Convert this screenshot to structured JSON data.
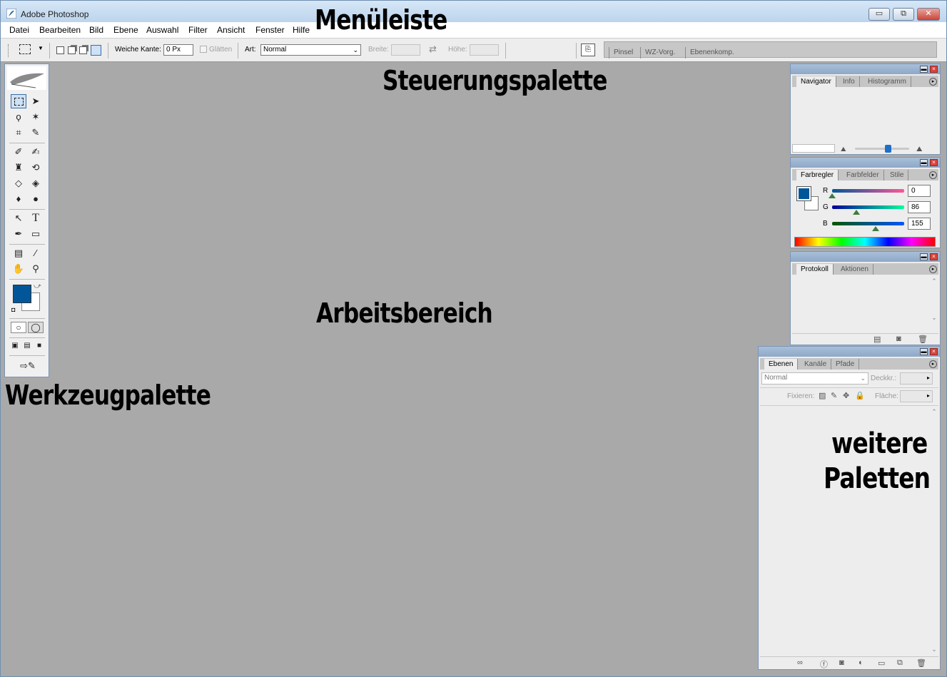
{
  "window": {
    "title": "Adobe Photoshop",
    "controls": {
      "minimize": "▭",
      "restore": "⧉",
      "close": "✕"
    }
  },
  "menu": [
    "Datei",
    "Bearbeiten",
    "Bild",
    "Ebene",
    "Auswahl",
    "Filter",
    "Ansicht",
    "Fenster",
    "Hilfe"
  ],
  "options": {
    "feather_label": "Weiche Kante:",
    "feather_value": "0 Px",
    "antialias_label": "Glätten",
    "style_label": "Art:",
    "style_value": "Normal",
    "width_label": "Breite:",
    "height_label": "Höhe:"
  },
  "palette_well": {
    "tabs": [
      "Pinsel",
      "WZ-Vorg.",
      "Ebenenkomp."
    ]
  },
  "navigator": {
    "tabs": [
      "Navigator",
      "Info",
      "Histogramm"
    ],
    "zoom_level": 0.6
  },
  "color": {
    "tabs": [
      "Farbregler",
      "Farbfelder",
      "Stile"
    ],
    "foreground": "#005699",
    "channels": [
      {
        "label": "R",
        "value": "0"
      },
      {
        "label": "G",
        "value": "86"
      },
      {
        "label": "B",
        "value": "155"
      }
    ]
  },
  "history": {
    "tabs": [
      "Protokoll",
      "Aktionen"
    ]
  },
  "layers": {
    "tabs": [
      "Ebenen",
      "Kanäle",
      "Pfade"
    ],
    "blend_mode": "Normal",
    "opacity_label": "Deckkr.:",
    "lock_label": "Fixieren:",
    "fill_label": "Fläche:"
  },
  "annotations": {
    "menubar": "Menüleiste",
    "options": "Steuerungspalette",
    "workspace": "Arbeitsbereich",
    "toolbox": "Werkzeugpalette",
    "more_palettes_line1": "weitere",
    "more_palettes_line2": "Paletten"
  },
  "toolbox": {
    "foreground": "#005699",
    "background": "#ffffff"
  }
}
